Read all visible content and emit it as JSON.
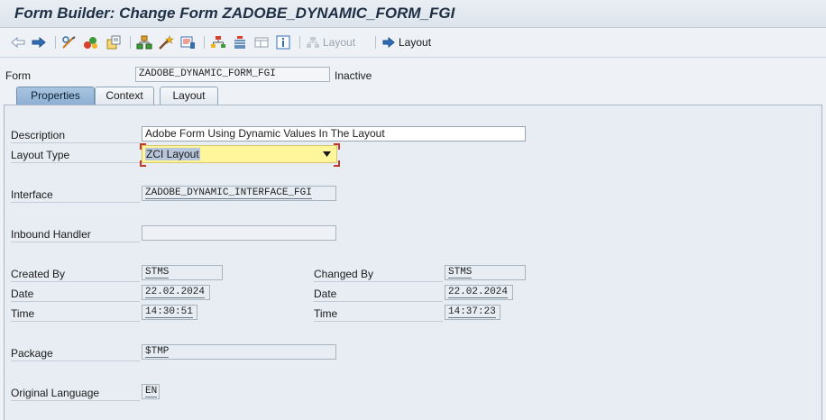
{
  "window": {
    "title": "Form Builder: Change Form ZADOBE_DYNAMIC_FORM_FGI"
  },
  "toolbar": {
    "icons": [
      "back-arrow-icon",
      "forward-arrow-icon",
      "display-change-icon",
      "activate-icon",
      "object-list-icon",
      "hierarchy-icon",
      "magic-wand-icon",
      "print-preview-icon",
      "layout-tree-icon",
      "align-icon",
      "frame-icon",
      "info-icon"
    ],
    "layout_disabled_label": "Layout",
    "layout_label": "Layout"
  },
  "header": {
    "form_label": "Form",
    "form_value": "ZADOBE_DYNAMIC_FORM_FGI",
    "status": "Inactive"
  },
  "tabs": [
    {
      "label": "Properties",
      "active": true
    },
    {
      "label": "Context",
      "active": false
    },
    {
      "label": "Layout",
      "active": false
    }
  ],
  "properties": {
    "description_label": "Description",
    "description_value": "Adobe Form Using Dynamic Values In The Layout",
    "layout_type_label": "Layout Type",
    "layout_type_value": "ZCI Layout",
    "interface_label": "Interface",
    "interface_value": "ZADOBE_DYNAMIC_INTERFACE_FGI",
    "inbound_handler_label": "Inbound Handler",
    "inbound_handler_value": "",
    "created_by_label": "Created By",
    "created_by_value": "STMS",
    "created_date_label": "Date",
    "created_date_value": "22.02.2024",
    "created_time_label": "Time",
    "created_time_value": "14:30:51",
    "changed_by_label": "Changed By",
    "changed_by_value": "STMS",
    "changed_date_label": "Date",
    "changed_date_value": "22.02.2024",
    "changed_time_label": "Time",
    "changed_time_value": "14:37:23",
    "package_label": "Package",
    "package_value": "$TMP",
    "original_language_label": "Original Language",
    "original_language_value": "EN"
  }
}
